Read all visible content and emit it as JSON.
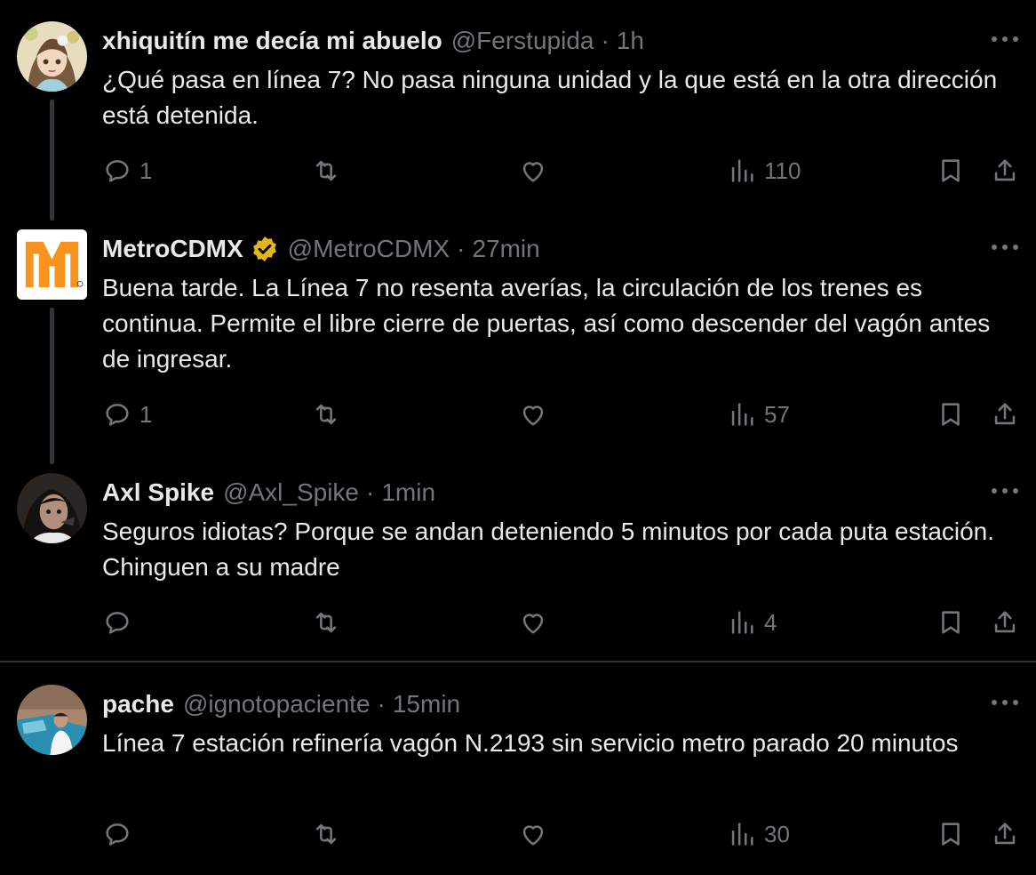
{
  "colors": {
    "background": "#000000",
    "text": "#e7e9ea",
    "muted": "#71767b",
    "divider": "#2f3336",
    "verified_gold": "#e2b719",
    "metro_orange": "#f7931e"
  },
  "tweets": [
    {
      "name": "xhiquitín me decía mi abuelo",
      "handle": "@Ferstupida",
      "separator": "·",
      "time": "1h",
      "text": "¿Qué pasa en línea 7? No pasa ninguna unidad y la que está en la otra dirección está detenida.",
      "replies": "1",
      "views": "110",
      "avatar_icon": "anime-girl-avatar"
    },
    {
      "name": "MetroCDMX",
      "verified": "gold-verified-badge-icon",
      "handle": "@MetroCDMX",
      "separator": "·",
      "time": "27min",
      "text": "Buena tarde. La Línea 7 no resenta averías, la circulación de los trenes es continua. Permite el libre cierre de puertas, así como descender del vagón antes de ingresar.",
      "replies": "1",
      "views": "57",
      "avatar_icon": "metro-logo-avatar"
    },
    {
      "name": "Axl Spike",
      "handle": "@Axl_Spike",
      "separator": "·",
      "time": "1min",
      "text": "Seguros idiotas? Porque se andan deteniendo 5 minutos por cada puta estación. Chinguen a su madre",
      "replies": "",
      "views": "4",
      "avatar_icon": "person-photo-avatar"
    },
    {
      "name": "pache",
      "handle": "@ignotopaciente",
      "separator": "·",
      "time": "15min",
      "text": "Línea 7 estación refinería vagón N.2193 sin servicio metro parado 20 minutos",
      "replies": "",
      "views": "30",
      "avatar_icon": "car-photo-avatar"
    }
  ]
}
